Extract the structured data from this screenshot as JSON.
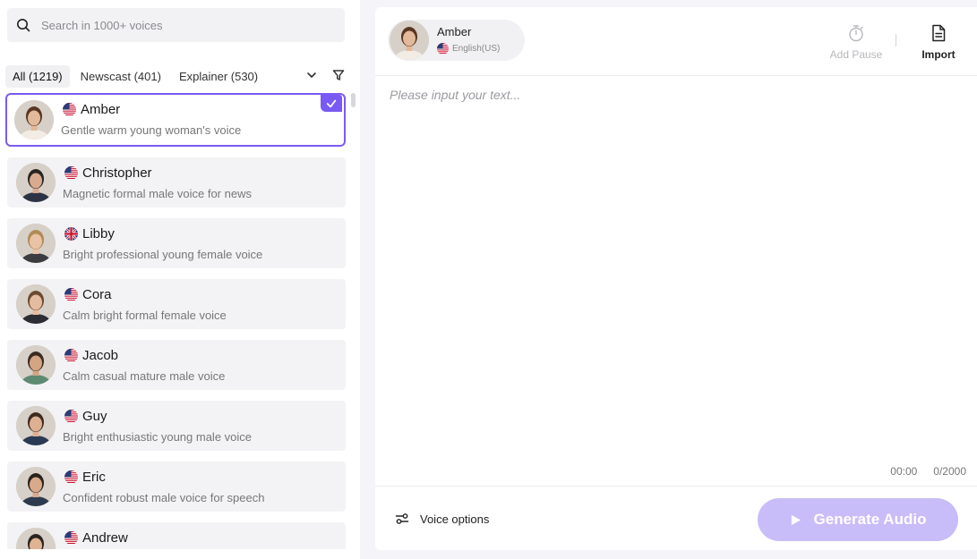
{
  "search": {
    "placeholder": "Search in 1000+ voices"
  },
  "tabs": [
    {
      "label": "All (1219)",
      "active": true
    },
    {
      "label": "Newscast (401)",
      "active": false
    },
    {
      "label": "Explainer (530)",
      "active": false
    }
  ],
  "voices": [
    {
      "name": "Amber",
      "desc": "Gentle warm young woman's voice",
      "flag": "us",
      "selected": true,
      "skin": "#e2b99b",
      "hair": "#5a3622",
      "shirt": "#f2ece4"
    },
    {
      "name": "Christopher",
      "desc": "Magnetic formal male voice for news",
      "flag": "us",
      "selected": false,
      "skin": "#d9ab8e",
      "hair": "#2a2420",
      "shirt": "#2d3345"
    },
    {
      "name": "Libby",
      "desc": "Bright professional young female voice",
      "flag": "uk",
      "selected": false,
      "skin": "#eac2a6",
      "hair": "#b08a55",
      "shirt": "#3b3b40"
    },
    {
      "name": "Cora",
      "desc": "Calm bright formal female voice",
      "flag": "us",
      "selected": false,
      "skin": "#e6bca0",
      "hair": "#6b4a30",
      "shirt": "#2c2c34"
    },
    {
      "name": "Jacob",
      "desc": "Calm casual mature male voice",
      "flag": "us",
      "selected": false,
      "skin": "#d4a483",
      "hair": "#3a2c22",
      "shirt": "#5e8a72"
    },
    {
      "name": "Guy",
      "desc": "Bright enthusiastic young male voice",
      "flag": "us",
      "selected": false,
      "skin": "#deb092",
      "hair": "#3d2b1f",
      "shirt": "#2a3a55"
    },
    {
      "name": "Eric",
      "desc": "Confident robust male voice for speech",
      "flag": "us",
      "selected": false,
      "skin": "#d8a98a",
      "hair": "#2b221c",
      "shirt": "#2e3b4f"
    },
    {
      "name": "Andrew",
      "desc": "",
      "flag": "us",
      "selected": false,
      "skin": "#e0b393",
      "hair": "#2b2420",
      "shirt": "#1f2533"
    }
  ],
  "editor": {
    "current_voice": {
      "name": "Amber",
      "language": "English(US)"
    },
    "add_pause_label": "Add Pause",
    "import_label": "Import",
    "text_placeholder": "Please input your text...",
    "text_value": "",
    "time": "00:00",
    "char_count": "0/2000",
    "voice_options_label": "Voice options",
    "generate_label": "Generate Audio"
  },
  "colors": {
    "accent": "#7a5af5",
    "generate_disabled": "#c8bdf8"
  }
}
